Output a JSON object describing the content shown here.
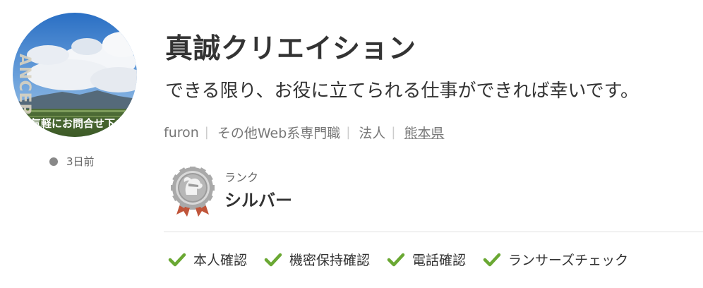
{
  "profile": {
    "avatar_caption": "ANCERS",
    "avatar_overlay_text": "お気軽にお問合せ下さい",
    "last_active": "3日前",
    "name": "真誠クリエイション",
    "catchphrase": "できる限り、お役に立てられる仕事ができれば幸いです。",
    "meta": {
      "username": "furon",
      "category": "その他Web系専門職",
      "type": "法人",
      "location": "熊本県"
    }
  },
  "rank": {
    "label": "ランク",
    "value": "シルバー",
    "badge_icon": "silver-rank-medal-icon"
  },
  "verifications": [
    {
      "label": "本人確認",
      "icon": "check-icon"
    },
    {
      "label": "機密保持確認",
      "icon": "check-icon"
    },
    {
      "label": "電話確認",
      "icon": "check-icon"
    },
    {
      "label": "ランサーズチェック",
      "icon": "check-icon"
    }
  ],
  "colors": {
    "text": "#333333",
    "muted": "#777777",
    "check": "#6aa833",
    "status_dot": "#888888",
    "divider": "#e2e2e2",
    "badge_ribbon": "#c0553a"
  }
}
